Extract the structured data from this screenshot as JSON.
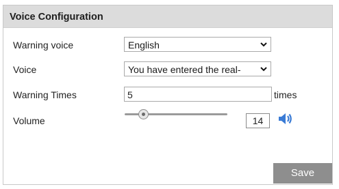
{
  "panel": {
    "title": "Voice Configuration"
  },
  "fields": {
    "warning_voice": {
      "label": "Warning voice",
      "value": "English"
    },
    "voice": {
      "label": "Voice",
      "value": "You have entered the real-"
    },
    "warning_times": {
      "label": "Warning Times",
      "value": "5",
      "unit": "times"
    },
    "volume": {
      "label": "Volume",
      "value": "14",
      "level_fraction": 0.14
    }
  },
  "actions": {
    "save_label": "Save"
  },
  "icons": {
    "dropdown": "chevron-down-icon",
    "speaker": "speaker-icon"
  },
  "colors": {
    "header_bg": "#dcdcdc",
    "save_bg": "#8e8e8e",
    "speaker": "#3a7bd5"
  }
}
